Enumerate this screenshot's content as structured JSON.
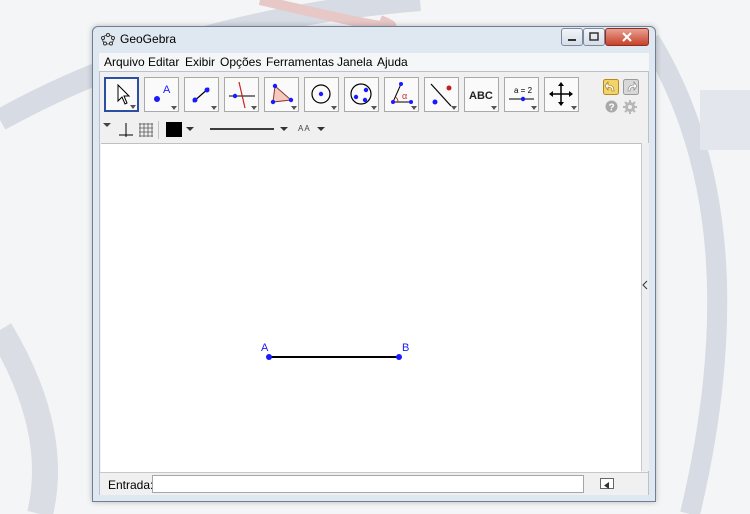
{
  "window": {
    "title": "GeoGebra"
  },
  "menu": {
    "items": [
      "Arquivo",
      "Editar",
      "Exibir",
      "Opções",
      "Ferramentas",
      "Janela",
      "Ajuda"
    ]
  },
  "toolbar": {
    "tools": [
      {
        "name": "move-tool",
        "icon": "arrow-pointer-icon",
        "selected": true
      },
      {
        "name": "new-point-tool",
        "icon": "point-icon",
        "selected": false
      },
      {
        "name": "line-tool",
        "icon": "line-icon",
        "selected": false
      },
      {
        "name": "perpendicular-line-tool",
        "icon": "perpendicular-icon",
        "selected": false
      },
      {
        "name": "polygon-tool",
        "icon": "polygon-icon",
        "selected": false
      },
      {
        "name": "circle-tool",
        "icon": "circle-icon",
        "selected": false
      },
      {
        "name": "ellipse-tool",
        "icon": "ellipse-icon",
        "selected": false
      },
      {
        "name": "angle-tool",
        "icon": "angle-icon",
        "selected": false
      },
      {
        "name": "reflect-tool",
        "icon": "reflect-icon",
        "selected": false
      },
      {
        "name": "text-tool",
        "icon": "text-icon",
        "label": "ABC",
        "selected": false
      },
      {
        "name": "slider-tool",
        "icon": "slider-icon",
        "label": "a = 2",
        "selected": false
      },
      {
        "name": "move-graphics-view-tool",
        "icon": "move-cross-icon",
        "selected": false
      }
    ],
    "undo_icon": "undo-icon",
    "redo_icon": "redo-icon",
    "help_icon": "help-icon",
    "settings_icon": "gear-icon"
  },
  "stylebar": {
    "axes_icon": "axes-icon",
    "grid_icon": "grid-icon",
    "color": "#000000",
    "font_label": "AA"
  },
  "graphics": {
    "points": [
      {
        "label": "A"
      },
      {
        "label": "B"
      }
    ],
    "point_color": "#1a1aff",
    "segment_color": "#000000"
  },
  "input": {
    "label": "Entrada:",
    "value": "",
    "placeholder": ""
  }
}
